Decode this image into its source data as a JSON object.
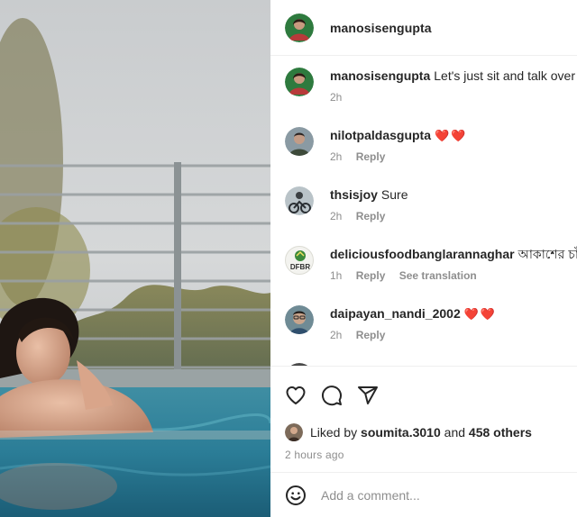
{
  "header": {
    "username": "manosisengupta"
  },
  "comments": [
    {
      "user": "manosisengupta",
      "text": "Let's just sit and talk over a",
      "time": "2h",
      "reply": "",
      "translate": "",
      "hearts": ""
    },
    {
      "user": "nilotpaldasgupta",
      "text": "",
      "time": "2h",
      "reply": "Reply",
      "translate": "",
      "hearts": "❤️❤️"
    },
    {
      "user": "thsisjoy",
      "text": "Sure",
      "time": "2h",
      "reply": "Reply",
      "translate": "",
      "hearts": ""
    },
    {
      "user": "deliciousfoodbanglarannaghar",
      "text": "আকাশের চাঁ",
      "time": "1h",
      "reply": "Reply",
      "translate": "See translation",
      "hearts": ""
    },
    {
      "user": "daipayan_nandi_2002",
      "text": "",
      "time": "2h",
      "reply": "Reply",
      "translate": "",
      "hearts": "❤️❤️"
    }
  ],
  "avatars": {
    "dfbr_text": "DFBR"
  },
  "likes": {
    "prefix": "Liked by",
    "user": "soumita.3010",
    "and": "and",
    "others": "458 others"
  },
  "time_ago": "2 hours ago",
  "comment_input": {
    "placeholder": "Add a comment..."
  },
  "icons": {
    "like": "heart-icon",
    "comment": "comment-icon",
    "share": "send-icon",
    "emoji": "emoji-icon"
  },
  "colors": {
    "heart": "#ed4956",
    "muted": "#8e8e8e",
    "text": "#262626",
    "divider": "#efefef"
  }
}
